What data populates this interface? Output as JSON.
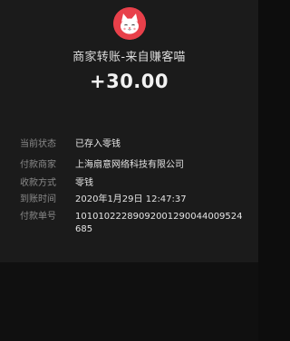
{
  "header": {
    "merchant_title": "商家转账-来自赚客喵",
    "amount": "+30.00"
  },
  "details": [
    {
      "label": "当前状态",
      "value": "已存入零钱"
    },
    {
      "label": "付款商家",
      "value": "上海扇意网络科技有限公司"
    },
    {
      "label": "收款方式",
      "value": "零钱"
    },
    {
      "label": "到账时间",
      "value": "2020年1月29日 12:47:37"
    },
    {
      "label": "付款单号",
      "value": "10101022289092001290044009524685"
    }
  ],
  "colors": {
    "card_bg": "#1b1b1b",
    "page_bg": "#0d0d0d",
    "avatar_bg": "#e8404a"
  },
  "icons": {
    "avatar": "lucky-cat-logo"
  }
}
